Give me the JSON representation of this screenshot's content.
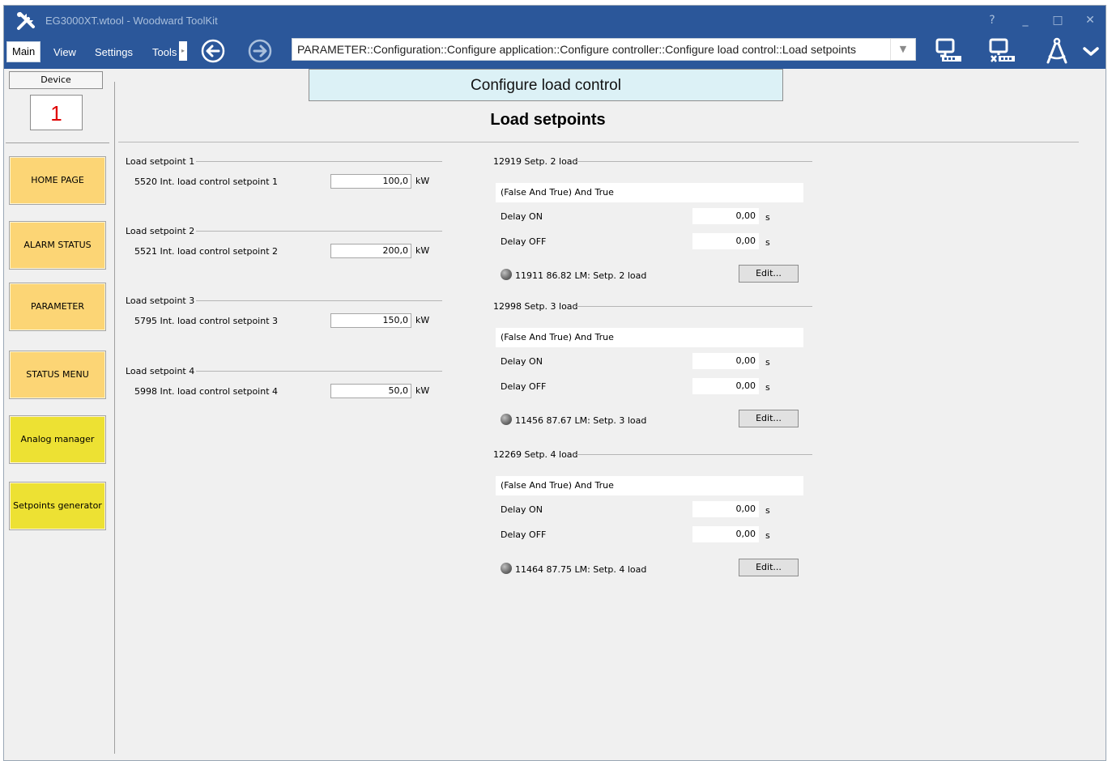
{
  "app": {
    "title": "EG3000XT.wtool - Woodward ToolKit",
    "window_buttons": [
      "?",
      "_",
      "□",
      "✕"
    ]
  },
  "menu": {
    "items": [
      "Main",
      "View",
      "Settings",
      "Tools"
    ],
    "overflow_glyph": "▸"
  },
  "nav": {
    "back_icon": "arrow-left-circle-icon",
    "forward_icon": "arrow-right-circle-icon"
  },
  "breadcrumb": {
    "path": "PARAMETER::Configuration::Configure application::Configure controller::Configure load control::Load setpoints",
    "dropdown_glyph": "▼"
  },
  "toolbar_icons": [
    "connect-icon",
    "disconnect-icon",
    "compass-tool-icon",
    "chevron-down-icon"
  ],
  "sidebar": {
    "device_label": "Device",
    "device_number": "1",
    "buttons": [
      {
        "label": "HOME PAGE",
        "color": "orange"
      },
      {
        "label": "ALARM STATUS",
        "color": "orange"
      },
      {
        "label": "PARAMETER",
        "color": "orange"
      },
      {
        "label": "STATUS MENU",
        "color": "orange"
      },
      {
        "label": "Analog manager",
        "color": "yellow"
      },
      {
        "label": "Setpoints generator",
        "color": "yellow"
      }
    ]
  },
  "header": {
    "section": "Configure load control",
    "page_title": "Load setpoints"
  },
  "setpoints": [
    {
      "group": "Load setpoint 1",
      "label": "5520 Int. load control setpoint 1",
      "value": "100,0",
      "unit": "kW"
    },
    {
      "group": "Load setpoint 2",
      "label": "5521 Int. load control setpoint 2",
      "value": "200,0",
      "unit": "kW"
    },
    {
      "group": "Load setpoint 3",
      "label": "5795 Int. load control setpoint 3",
      "value": "150,0",
      "unit": "kW"
    },
    {
      "group": "Load setpoint 4",
      "label": "5998 Int. load control setpoint 4",
      "value": "50,0",
      "unit": "kW"
    }
  ],
  "logic_groups": [
    {
      "group": "12919 Setp. 2 load",
      "expression": "(False And True) And True",
      "delay_on_label": "Delay ON",
      "delay_on": "0,00",
      "delay_off_label": "Delay OFF",
      "delay_off": "0,00",
      "unit": "s",
      "status": "11911 86.82 LM: Setp. 2 load",
      "edit": "Edit..."
    },
    {
      "group": "12998 Setp. 3 load",
      "expression": "(False And True) And True",
      "delay_on_label": "Delay ON",
      "delay_on": "0,00",
      "delay_off_label": "Delay OFF",
      "delay_off": "0,00",
      "unit": "s",
      "status": "11456 87.67 LM: Setp. 3 load",
      "edit": "Edit..."
    },
    {
      "group": "12269 Setp. 4 load",
      "expression": "(False And True) And True",
      "delay_on_label": "Delay ON",
      "delay_on": "0,00",
      "delay_off_label": "Delay OFF",
      "delay_off": "0,00",
      "unit": "s",
      "status": "11464 87.75 LM: Setp. 4 load",
      "edit": "Edit..."
    }
  ]
}
